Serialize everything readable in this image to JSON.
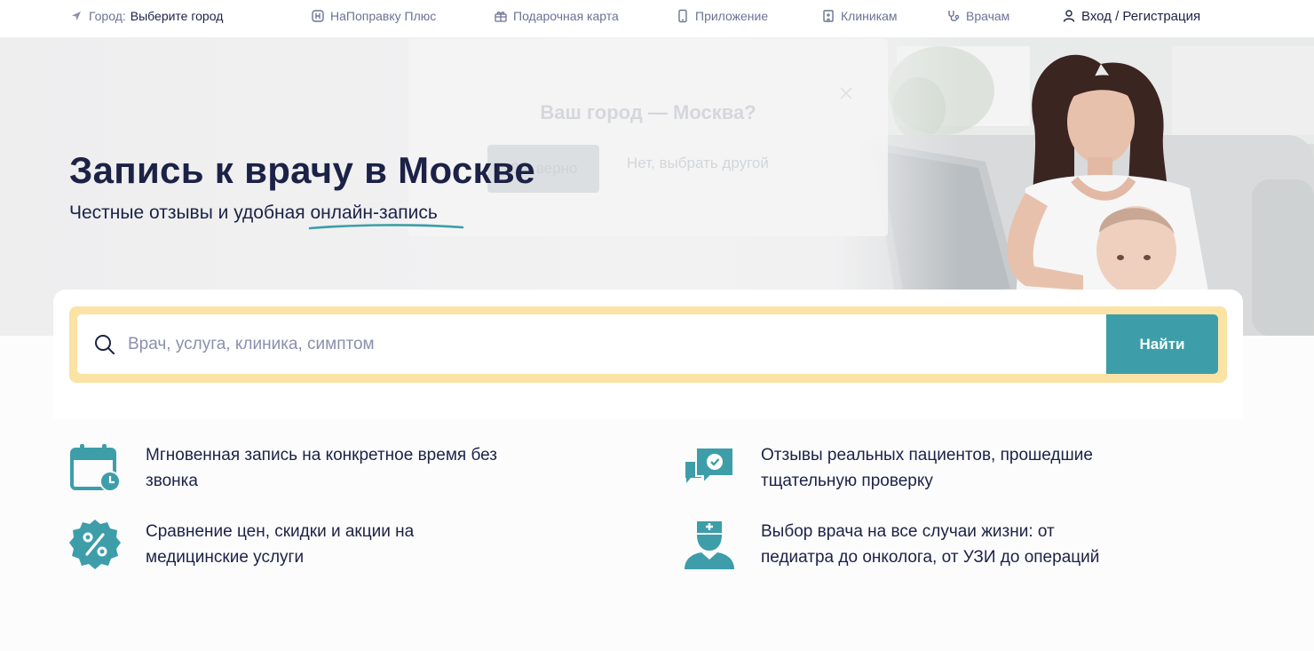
{
  "topbar": {
    "city_label": "Город:",
    "city_value": "Выберите город",
    "links": [
      {
        "label": "НаПоправку Плюс",
        "icon": "plus-badge-icon"
      },
      {
        "label": "Подарочная карта",
        "icon": "gift-icon"
      },
      {
        "label": "Приложение",
        "icon": "phone-icon"
      },
      {
        "label": "Клиникам",
        "icon": "clinic-building-icon"
      },
      {
        "label": "Врачам",
        "icon": "stethoscope-icon"
      }
    ],
    "login_label": "Вход / Регистрация"
  },
  "city_popup": {
    "title": "Ваш город — Москва?",
    "yes_label": "Да, верно",
    "no_label": "Нет, выбрать другой"
  },
  "hero": {
    "title": "Запись к врачу в Москве",
    "subtitle_plain": "Честные отзывы и удобная",
    "subtitle_underlined": "онлайн-запись"
  },
  "search": {
    "placeholder": "Врач, услуга, клиника, симптом",
    "value": "",
    "button_label": "Найти"
  },
  "features": [
    {
      "icon": "calendar-clock-icon",
      "line1": "Мгновенная запись на конкретное время без",
      "line2": "звонка"
    },
    {
      "icon": "reviews-check-icon",
      "line1": "Отзывы реальных пациентов, прошедшие",
      "line2": "тщательную проверку"
    },
    {
      "icon": "discount-percent-icon",
      "line1": "Сравнение цен, скидки и акции на",
      "line2": "медицинские услуги"
    },
    {
      "icon": "doctor-icon",
      "line1": "Выбор врача на все случаи жизни: от",
      "line2": "педиатра до онколога, от УЗИ до операций"
    }
  ],
  "colors": {
    "accent": "#3d9ea9",
    "text_dark": "#1c2246",
    "search_frame": "#fbe3a5",
    "muted": "#6b7396"
  }
}
